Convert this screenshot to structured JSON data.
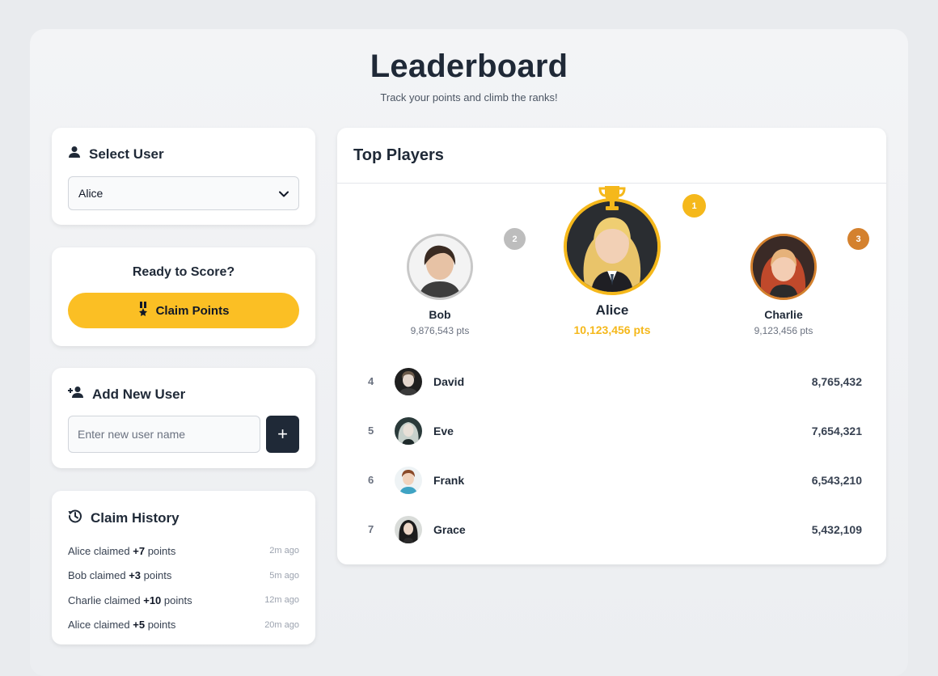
{
  "header": {
    "title": "Leaderboard",
    "subtitle": "Track your points and climb the ranks!"
  },
  "select_user": {
    "title": "Select User",
    "selected": "Alice"
  },
  "claim": {
    "title": "Ready to Score?",
    "button_label": "Claim Points"
  },
  "add_user": {
    "title": "Add New User",
    "placeholder": "Enter new user name",
    "button_label": "+"
  },
  "history": {
    "title": "Claim History",
    "items": [
      {
        "user": "Alice",
        "claimed": "claimed",
        "points": "+7",
        "suffix": "points",
        "time": "2m ago"
      },
      {
        "user": "Bob",
        "claimed": "claimed",
        "points": "+3",
        "suffix": "points",
        "time": "5m ago"
      },
      {
        "user": "Charlie",
        "claimed": "claimed",
        "points": "+10",
        "suffix": "points",
        "time": "12m ago"
      },
      {
        "user": "Alice",
        "claimed": "claimed",
        "points": "+5",
        "suffix": "points",
        "time": "20m ago"
      }
    ]
  },
  "top_players": {
    "title": "Top Players",
    "podium": {
      "first": {
        "rank": "1",
        "name": "Alice",
        "points": "10,123,456 pts"
      },
      "second": {
        "rank": "2",
        "name": "Bob",
        "points": "9,876,543 pts"
      },
      "third": {
        "rank": "3",
        "name": "Charlie",
        "points": "9,123,456 pts"
      }
    },
    "list": [
      {
        "rank": "4",
        "name": "David",
        "score": "8,765,432"
      },
      {
        "rank": "5",
        "name": "Eve",
        "score": "7,654,321"
      },
      {
        "rank": "6",
        "name": "Frank",
        "score": "6,543,210"
      },
      {
        "rank": "7",
        "name": "Grace",
        "score": "5,432,109"
      }
    ]
  },
  "colors": {
    "accent": "#fbbf24",
    "gold": "#f5b81b",
    "silver": "#bdbdbd",
    "bronze": "#d4812e",
    "dark": "#1f2937"
  }
}
